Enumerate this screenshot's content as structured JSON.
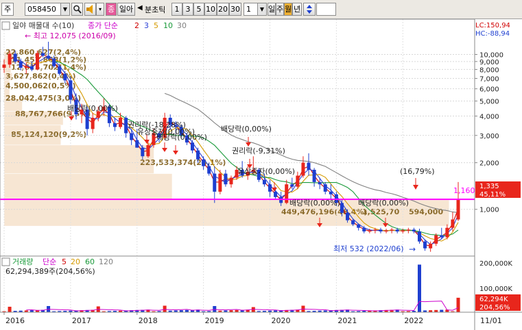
{
  "toolbar": {
    "market_type": "주",
    "stock_code": "058450",
    "search_icon": "magnifier-icon",
    "sound_icon": "speaker-icon",
    "sound_dropdown": "▾",
    "price_type_label": "종",
    "pack_label": "일아",
    "prev_arrow": "◀",
    "interval_unit": "분초틱",
    "intervals": [
      "1",
      "3",
      "5",
      "10",
      "20",
      "30"
    ],
    "count_value": "1",
    "periods": [
      "일",
      "주",
      "월",
      "년"
    ],
    "selected_period": "월",
    "updown_icon": "updown-arrows-icon",
    "date_value": ""
  },
  "price_panel": {
    "title_prefix": "일야 매물대 수(10)",
    "ma_label": "종가 단순",
    "ma_periods": [
      "2",
      "3",
      "5",
      "10",
      "30"
    ],
    "lc": "LC:150,94",
    "hc": "HC:-88,94",
    "y_ticks": [
      "10,000",
      "9,000",
      "8,000",
      "7,000",
      "6,000",
      "5,000",
      "4,000",
      "3,000",
      "2,000",
      "1,000"
    ],
    "current_price": "1,160",
    "badge_price": "1,335",
    "badge_pct": "45,11%",
    "annotations": {
      "high": "← 최고 12,075 (2016/09)",
      "low": "최저 532 (2022/06)",
      "low_arrow": "→",
      "pct_top": "(16,79%)"
    },
    "profile_labels": [
      "22,860,627(2,4%)",
      "11,457,868(1,2%)",
      "12,615,702(1,4%)",
      "3,627,862(0,4%)",
      "4,500,062(0,5%)",
      "28,042,475(3,0%)",
      "88,767,766(9,5%)",
      "85,124,120(9,2%)",
      "223,533,374(24,1%)",
      "449,476,196(48,4%)",
      "1,525,70",
      "594,000"
    ],
    "events": [
      {
        "label": "배당락(0,00%)"
      },
      {
        "label": "권리락(-18,28%)"
      },
      {
        "label": "유상증자(0,00%)"
      },
      {
        "label": "배당락(0,00%)"
      },
      {
        "label": "배당락(0,00%)"
      },
      {
        "label": "권리락(-9,31%)"
      },
      {
        "label": "유상증자(0,00%)"
      },
      {
        "label": "배당락(0,00%)"
      },
      {
        "label": "배당락(0,00%)"
      }
    ]
  },
  "volume_panel": {
    "title": "거래량",
    "ma_label": "단순",
    "ma_periods": [
      "5",
      "20",
      "60",
      "120"
    ],
    "summary": "62,294,389주(204,56%)",
    "y_ticks": [
      "200,000K",
      "100,000K"
    ],
    "badge_value": "62,294K",
    "badge_pct": "204,56%"
  },
  "x_axis": {
    "labels": [
      "2016",
      "2017",
      "2018",
      "2019",
      "2020",
      "2021",
      "2022",
      "11/01"
    ]
  },
  "colors": {
    "up": "#e8261c",
    "down": "#1e3fd0",
    "ma2": "#d00000",
    "ma3": "#2a3fd6",
    "ma5": "#d59a00",
    "ma10": "#1a9a3a",
    "ma30": "#808080",
    "profile": "#f7e6d3",
    "current_line": "#ff00ff"
  },
  "chart_data": {
    "type": "candlestick",
    "title": "",
    "y_scale": "log",
    "ylim": [
      520,
      13500
    ],
    "x_range": [
      "2016-01",
      "2022-11"
    ],
    "candles": [
      [
        "2016-01",
        8200,
        9300,
        7600,
        8600
      ],
      [
        "2016-02",
        8600,
        10500,
        8200,
        10100
      ],
      [
        "2016-03",
        10100,
        10600,
        8700,
        9000
      ],
      [
        "2016-04",
        9000,
        9400,
        7900,
        8200
      ],
      [
        "2016-05",
        8200,
        8900,
        7500,
        8400
      ],
      [
        "2016-06",
        8400,
        9000,
        7800,
        8000
      ],
      [
        "2016-07",
        8000,
        10600,
        7900,
        10200
      ],
      [
        "2016-08",
        10200,
        11200,
        9600,
        9800
      ],
      [
        "2016-09",
        9800,
        12075,
        9200,
        9400
      ],
      [
        "2016-10",
        9400,
        9800,
        8200,
        8400
      ],
      [
        "2016-11",
        8400,
        8700,
        7300,
        7500
      ],
      [
        "2016-12",
        7500,
        7800,
        6500,
        6800
      ],
      [
        "2017-01",
        6800,
        7200,
        4800,
        5100
      ],
      [
        "2017-02",
        5100,
        5600,
        3800,
        4100
      ],
      [
        "2017-03",
        4100,
        4800,
        3600,
        4400
      ],
      [
        "2017-04",
        4400,
        4600,
        3000,
        3300
      ],
      [
        "2017-05",
        3300,
        4200,
        3100,
        3900
      ],
      [
        "2017-06",
        3900,
        4600,
        3700,
        4300
      ],
      [
        "2017-07",
        4300,
        5200,
        4000,
        4600
      ],
      [
        "2017-08",
        4600,
        4800,
        3400,
        3600
      ],
      [
        "2017-09",
        3600,
        3900,
        3200,
        3400
      ],
      [
        "2017-10",
        3400,
        4200,
        3300,
        3900
      ],
      [
        "2017-11",
        3900,
        4000,
        2900,
        3100
      ],
      [
        "2017-12",
        3100,
        3300,
        2600,
        2800
      ],
      [
        "2018-01",
        2800,
        3300,
        2600,
        2500
      ],
      [
        "2018-02",
        2500,
        2600,
        2100,
        2200
      ],
      [
        "2018-03",
        2200,
        2800,
        2150,
        2600
      ],
      [
        "2018-04",
        2600,
        3300,
        2500,
        3100
      ],
      [
        "2018-05",
        3100,
        3200,
        2700,
        2900
      ],
      [
        "2018-06",
        2900,
        4200,
        2800,
        3900
      ],
      [
        "2018-07",
        3900,
        4100,
        3300,
        3500
      ],
      [
        "2018-08",
        3500,
        3700,
        3100,
        3400
      ],
      [
        "2018-09",
        3400,
        3500,
        2900,
        3000
      ],
      [
        "2018-10",
        3000,
        3100,
        2600,
        2700
      ],
      [
        "2018-11",
        2700,
        2800,
        2300,
        2400
      ],
      [
        "2018-12",
        2400,
        2500,
        2000,
        2100
      ],
      [
        "2019-01",
        2100,
        2200,
        1800,
        1900
      ],
      [
        "2019-02",
        1900,
        2000,
        1650,
        1700
      ],
      [
        "2019-03",
        1700,
        1900,
        1100,
        1300
      ],
      [
        "2019-04",
        1300,
        1800,
        1250,
        1700
      ],
      [
        "2019-05",
        1700,
        1800,
        1400,
        1450
      ],
      [
        "2019-06",
        1450,
        1650,
        1380,
        1600
      ],
      [
        "2019-07",
        1600,
        1900,
        1550,
        1800
      ],
      [
        "2019-08",
        1800,
        2050,
        1600,
        1650
      ],
      [
        "2019-09",
        1650,
        1900,
        1550,
        1750
      ],
      [
        "2019-10",
        1750,
        2200,
        1700,
        1800
      ],
      [
        "2019-11",
        1800,
        1850,
        1500,
        1550
      ],
      [
        "2019-12",
        1550,
        1700,
        1400,
        1450
      ],
      [
        "2020-01",
        1450,
        1550,
        1200,
        1300
      ],
      [
        "2020-02",
        1300,
        1400,
        1150,
        1200
      ],
      [
        "2020-03",
        1200,
        1300,
        1050,
        1100
      ],
      [
        "2020-04",
        1100,
        1550,
        1080,
        1450
      ],
      [
        "2020-05",
        1450,
        1600,
        1350,
        1400
      ],
      [
        "2020-06",
        1400,
        1750,
        1350,
        1650
      ],
      [
        "2020-07",
        1650,
        2200,
        1600,
        2000
      ],
      [
        "2020-08",
        2000,
        2300,
        1650,
        1800
      ],
      [
        "2020-09",
        1800,
        1850,
        1400,
        1500
      ],
      [
        "2020-10",
        1500,
        1600,
        1350,
        1450
      ],
      [
        "2020-11",
        1450,
        1500,
        1250,
        1300
      ],
      [
        "2020-12",
        1300,
        1450,
        1150,
        1250
      ],
      [
        "2021-01",
        1250,
        1300,
        1050,
        1100
      ],
      [
        "2021-02",
        1100,
        1150,
        900,
        950
      ],
      [
        "2021-03",
        950,
        1000,
        820,
        850
      ],
      [
        "2021-04",
        850,
        870,
        780,
        800
      ],
      [
        "2021-05",
        800,
        810,
        730,
        760
      ],
      [
        "2021-06",
        760,
        780,
        700,
        720
      ],
      [
        "2021-07",
        720,
        750,
        700,
        730
      ],
      [
        "2021-08",
        730,
        760,
        700,
        740
      ],
      [
        "2021-09",
        740,
        760,
        700,
        720
      ],
      [
        "2021-10",
        720,
        750,
        700,
        730
      ],
      [
        "2021-11",
        730,
        760,
        700,
        740
      ],
      [
        "2021-12",
        740,
        760,
        700,
        720
      ],
      [
        "2022-01",
        720,
        750,
        700,
        730
      ],
      [
        "2022-02",
        730,
        760,
        700,
        740
      ],
      [
        "2022-03",
        740,
        760,
        700,
        720
      ],
      [
        "2022-04",
        720,
        750,
        600,
        620
      ],
      [
        "2022-05",
        620,
        640,
        540,
        560
      ],
      [
        "2022-06",
        560,
        620,
        532,
        600
      ],
      [
        "2022-07",
        600,
        700,
        580,
        680
      ],
      [
        "2022-08",
        680,
        760,
        640,
        660
      ],
      [
        "2022-09",
        660,
        800,
        640,
        760
      ],
      [
        "2022-10",
        760,
        960,
        720,
        860
      ],
      [
        "2022-11",
        860,
        1500,
        840,
        1160
      ]
    ],
    "volume_ylim": [
      0,
      230000
    ],
    "volume_unit": "K"
  }
}
